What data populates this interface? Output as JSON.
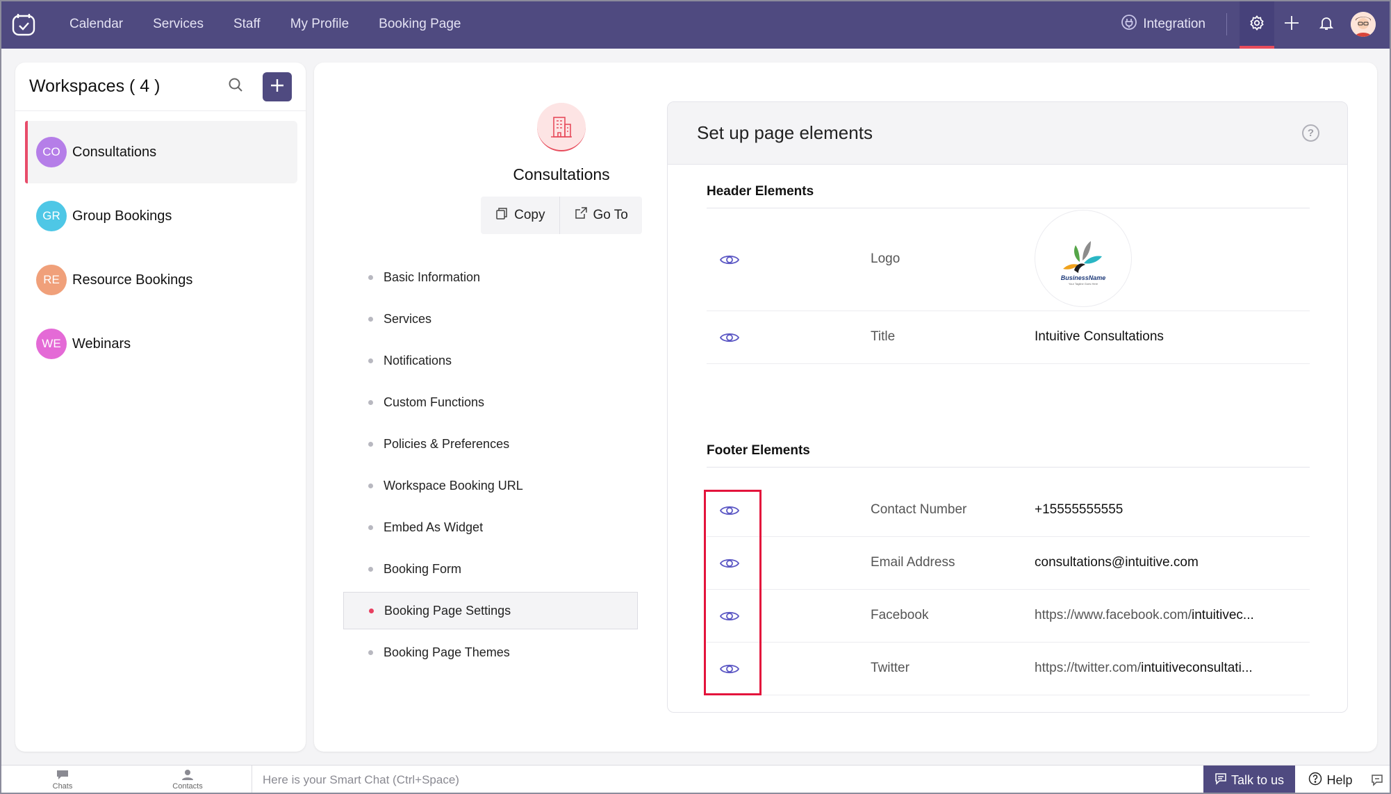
{
  "nav": {
    "items": [
      "Calendar",
      "Services",
      "Staff",
      "My Profile",
      "Booking Page"
    ],
    "integration": "Integration"
  },
  "workspaces": {
    "title": "Workspaces ( 4 )",
    "items": [
      {
        "initials": "CO",
        "name": "Consultations",
        "color": "#b57ee8"
      },
      {
        "initials": "GR",
        "name": "Group Bookings",
        "color": "#4ec7e6"
      },
      {
        "initials": "RE",
        "name": "Resource Bookings",
        "color": "#f0a07a"
      },
      {
        "initials": "WE",
        "name": "Webinars",
        "color": "#e46ad6"
      }
    ]
  },
  "workspace_header": {
    "name": "Consultations",
    "copy_label": "Copy",
    "goto_label": "Go To"
  },
  "settings_nav": [
    "Basic Information",
    "Services",
    "Notifications",
    "Custom Functions",
    "Policies & Preferences",
    "Workspace Booking URL",
    "Embed As Widget",
    "Booking Form",
    "Booking Page Settings",
    "Booking Page Themes"
  ],
  "setup": {
    "title": "Set up page elements",
    "header_section": "Header Elements",
    "footer_section": "Footer Elements",
    "header_rows": [
      {
        "field": "Logo"
      },
      {
        "field": "Title",
        "value": "Intuitive Consultations"
      }
    ],
    "logo_text": {
      "brand": "BusinessName",
      "tagline": "Your Tagline Goes Here"
    },
    "footer_rows": [
      {
        "field": "Contact Number",
        "value": "+15555555555"
      },
      {
        "field": "Email Address",
        "value": "consultations@intuitive.com"
      },
      {
        "field": "Facebook",
        "value_prefix": "https://www.facebook.com/",
        "value_rest": "intuitivec..."
      },
      {
        "field": "Twitter",
        "value_prefix": "https://twitter.com/",
        "value_rest": "intuitiveconsultati..."
      }
    ]
  },
  "bottom": {
    "chats": "Chats",
    "contacts": "Contacts",
    "chat_placeholder": "Here is your Smart Chat (Ctrl+Space)",
    "talk": "Talk to us",
    "help": "Help"
  },
  "colors": {
    "topbar": "#4f4a80",
    "accent": "#e84c6a",
    "eye": "#5b57c4"
  }
}
